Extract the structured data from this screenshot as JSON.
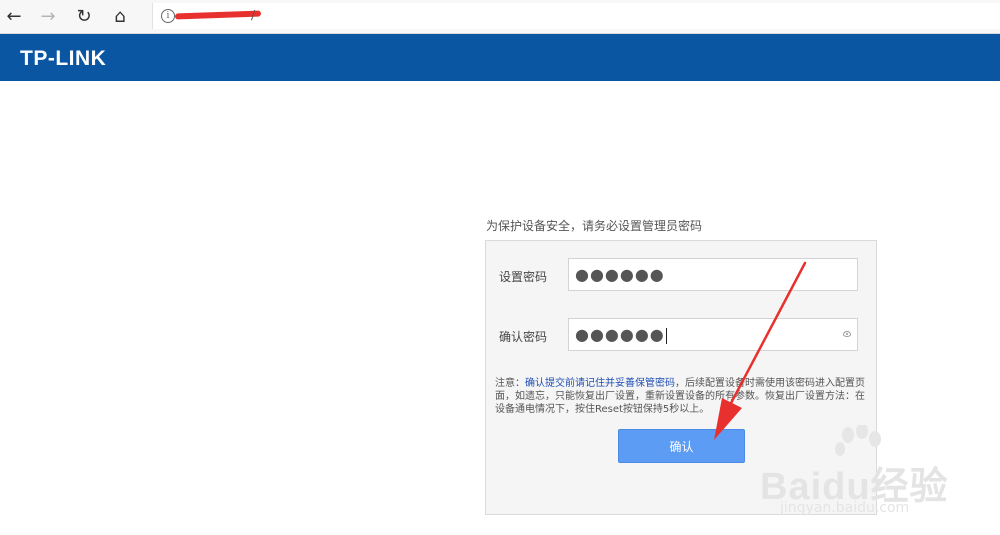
{
  "browser": {
    "back_icon": "←",
    "forward_icon": "→",
    "reload_icon": "↻",
    "home_icon": "⌂",
    "info_icon": "i",
    "url": "/"
  },
  "header": {
    "logo": "TP-LINK",
    "brand_color": "#0b56a3"
  },
  "form": {
    "notice": "为保护设备安全，请务必设置管理员密码",
    "set_password_label": "设置密码",
    "set_password_value": "●●●●●●",
    "confirm_password_label": "确认密码",
    "confirm_password_value": "●●●●●●",
    "note_prefix": "注意：",
    "note_highlight": "确认提交前请记住并妥善保管密码",
    "note_rest": "，后续配置设备时需使用该密码进入配置页面，如遗忘，只能恢复出厂设置，重新设置设备的所有参数。恢复出厂设置方法：在设备通电情况下，按住Reset按钮保持5秒以上。",
    "confirm_button": "确认",
    "button_color": "#5c9cf4"
  },
  "annotation": {
    "arrow_color": "#e8312f"
  },
  "watermark": {
    "text": "Baidu经验",
    "sub": "jingyan.baidu.com"
  }
}
